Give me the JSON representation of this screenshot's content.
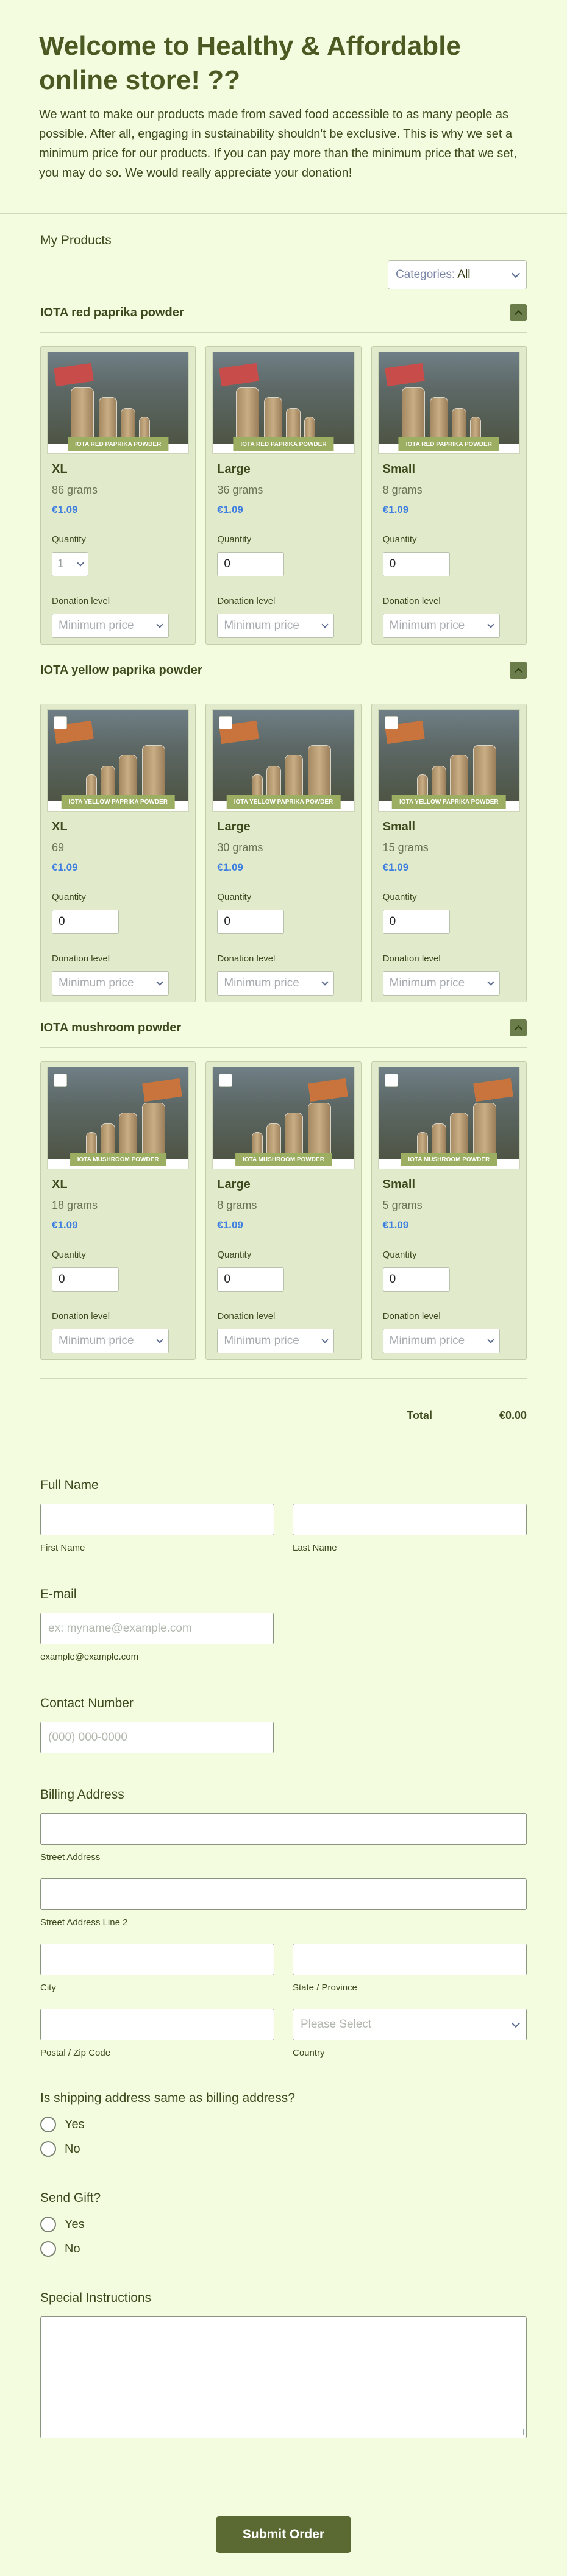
{
  "header": {
    "title": "Welcome to Healthy & Affordable online store! ??",
    "description": "We want to make our products made from saved food accessible to as many people as possible. After all, engaging in sustainability shouldn't be exclusive. This is why we set a minimum price for our products. If you can pay more than the minimum price that we set, you may do so. We would really appreciate your donation!"
  },
  "products": {
    "title": "My Products",
    "categories_label": "Categories:",
    "categories_value": "All",
    "quantity_label": "Quantity",
    "donation_label": "Donation level",
    "donation_placeholder": "Minimum price",
    "groups": [
      {
        "name": "IOTA red paprika powder",
        "banner": "IOTA RED PAPRIKA POWDER",
        "items": [
          {
            "size": "XL",
            "grams": "86 grams",
            "price": "€1.09",
            "qty": "1",
            "qty_type": "select"
          },
          {
            "size": "Large",
            "grams": "36 grams",
            "price": "€1.09",
            "qty": "0",
            "qty_type": "input"
          },
          {
            "size": "Small",
            "grams": "8 grams",
            "price": "€1.09",
            "qty": "0",
            "qty_type": "input"
          }
        ]
      },
      {
        "name": "IOTA yellow paprika powder",
        "banner": "IOTA YELLOW PAPRIKA POWDER",
        "items": [
          {
            "size": "XL",
            "grams": "69",
            "price": "€1.09",
            "qty": "0",
            "qty_type": "input"
          },
          {
            "size": "Large",
            "grams": "30 grams",
            "price": "€1.09",
            "qty": "0",
            "qty_type": "input"
          },
          {
            "size": "Small",
            "grams": "15 grams",
            "price": "€1.09",
            "qty": "0",
            "qty_type": "input"
          }
        ]
      },
      {
        "name": "IOTA mushroom powder",
        "banner": "IOTA MUSHROOM POWDER",
        "items": [
          {
            "size": "XL",
            "grams": "18 grams",
            "price": "€1.09",
            "qty": "0",
            "qty_type": "input"
          },
          {
            "size": "Large",
            "grams": "8 grams",
            "price": "€1.09",
            "qty": "0",
            "qty_type": "input"
          },
          {
            "size": "Small",
            "grams": "5 grams",
            "price": "€1.09",
            "qty": "0",
            "qty_type": "input"
          }
        ]
      }
    ],
    "total_label": "Total",
    "total_value": "€0.00"
  },
  "form": {
    "full_name_label": "Full Name",
    "first_name_sub": "First Name",
    "last_name_sub": "Last Name",
    "email_label": "E-mail",
    "email_placeholder": "ex: myname@example.com",
    "email_sub": "example@example.com",
    "contact_label": "Contact Number",
    "contact_placeholder": "(000) 000-0000",
    "billing_label": "Billing Address",
    "street_sub": "Street Address",
    "street2_sub": "Street Address Line 2",
    "city_sub": "City",
    "state_sub": "State / Province",
    "postal_sub": "Postal / Zip Code",
    "country_sub": "Country",
    "country_placeholder": "Please Select",
    "shipping_question": "Is shipping address same as billing address?",
    "gift_question": "Send Gift?",
    "yes": "Yes",
    "no": "No",
    "instructions_label": "Special Instructions",
    "submit_label": "Submit Order"
  }
}
